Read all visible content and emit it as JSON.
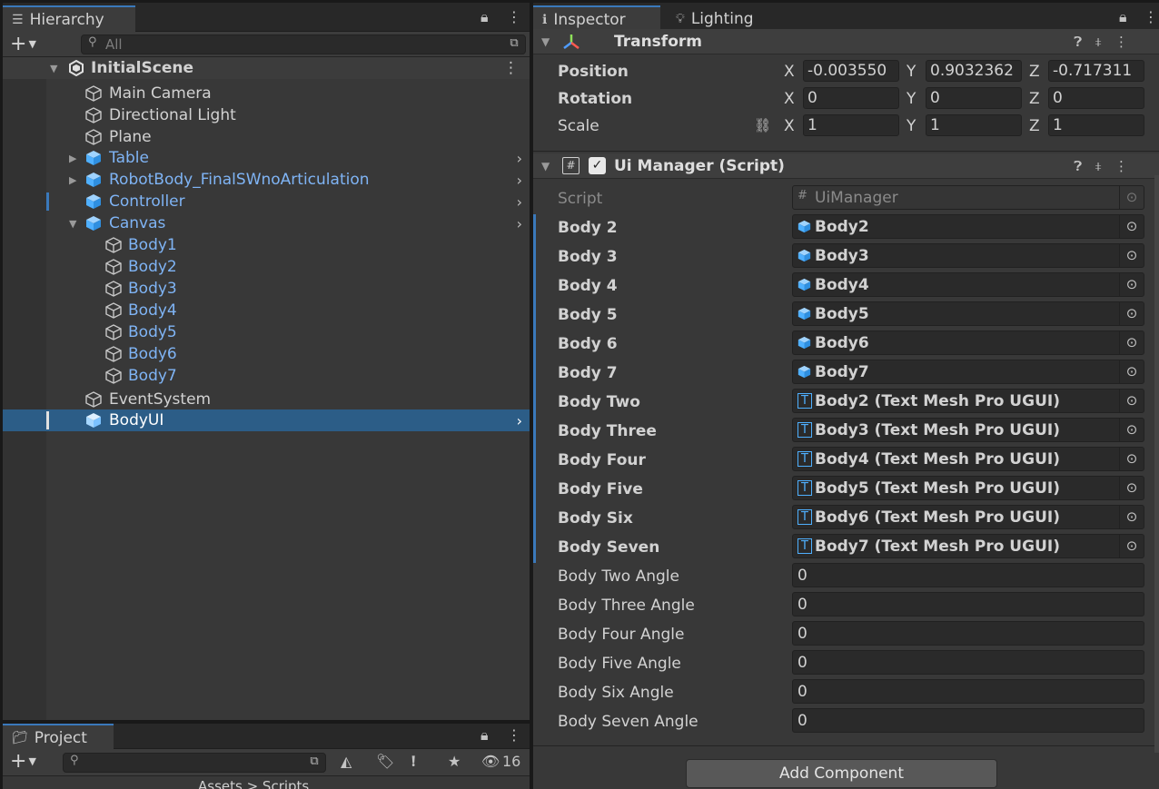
{
  "hierarchy": {
    "tab_label": "Hierarchy",
    "search_placeholder": "All",
    "scene_name": "InitialScene",
    "items": [
      {
        "label": "Main Camera"
      },
      {
        "label": "Directional Light"
      },
      {
        "label": "Plane"
      },
      {
        "label": "Table"
      },
      {
        "label": "RobotBody_FinalSWnoArticulation"
      },
      {
        "label": "Controller"
      },
      {
        "label": "Canvas"
      },
      {
        "label": "Body1"
      },
      {
        "label": "Body2"
      },
      {
        "label": "Body3"
      },
      {
        "label": "Body4"
      },
      {
        "label": "Body5"
      },
      {
        "label": "Body6"
      },
      {
        "label": "Body7"
      },
      {
        "label": "EventSystem"
      },
      {
        "label": "BodyUI"
      }
    ],
    "selected": "BodyUI"
  },
  "project": {
    "tab_label": "Project",
    "hidden_count": "16",
    "breadcrumb": "Assets  >  Scripts"
  },
  "inspector": {
    "tab_label": "Inspector",
    "lighting_tab_label": "Lighting",
    "transform": {
      "title": "Transform",
      "position_label": "Position",
      "rotation_label": "Rotation",
      "scale_label": "Scale",
      "position": {
        "x": "-0.003550",
        "y": "0.9032362",
        "z": "-0.717311"
      },
      "rotation": {
        "x": "0",
        "y": "0",
        "z": "0"
      },
      "scale": {
        "x": "1",
        "y": "1",
        "z": "1"
      },
      "axis_x": "X",
      "axis_y": "Y",
      "axis_z": "Z"
    },
    "script_component": {
      "title": "Ui Manager (Script)",
      "script_label": "Script",
      "script_value": "UiManager",
      "fields": [
        {
          "label": "Body 2",
          "value": "Body2"
        },
        {
          "label": "Body 3",
          "value": "Body3"
        },
        {
          "label": "Body 4",
          "value": "Body4"
        },
        {
          "label": "Body 5",
          "value": "Body5"
        },
        {
          "label": "Body 6",
          "value": "Body6"
        },
        {
          "label": "Body 7",
          "value": "Body7"
        },
        {
          "label": "Body Two",
          "value": "Body2 (Text Mesh Pro UGUI)"
        },
        {
          "label": "Body Three",
          "value": "Body3 (Text Mesh Pro UGUI)"
        },
        {
          "label": "Body Four",
          "value": "Body4 (Text Mesh Pro UGUI)"
        },
        {
          "label": "Body Five",
          "value": "Body5 (Text Mesh Pro UGUI)"
        },
        {
          "label": "Body Six",
          "value": "Body6 (Text Mesh Pro UGUI)"
        },
        {
          "label": "Body Seven",
          "value": "Body7 (Text Mesh Pro UGUI)"
        },
        {
          "label": "Body Two Angle",
          "value": "0"
        },
        {
          "label": "Body Three Angle",
          "value": "0"
        },
        {
          "label": "Body Four Angle",
          "value": "0"
        },
        {
          "label": "Body Five Angle",
          "value": "0"
        },
        {
          "label": "Body Six Angle",
          "value": "0"
        },
        {
          "label": "Body Seven Angle",
          "value": "0"
        }
      ]
    },
    "add_component_label": "Add Component"
  },
  "colors": {
    "accent": "#3a79bb",
    "prefab_text": "#7fb4f5",
    "selection": "#2c5d87",
    "panel_bg": "#383838"
  }
}
